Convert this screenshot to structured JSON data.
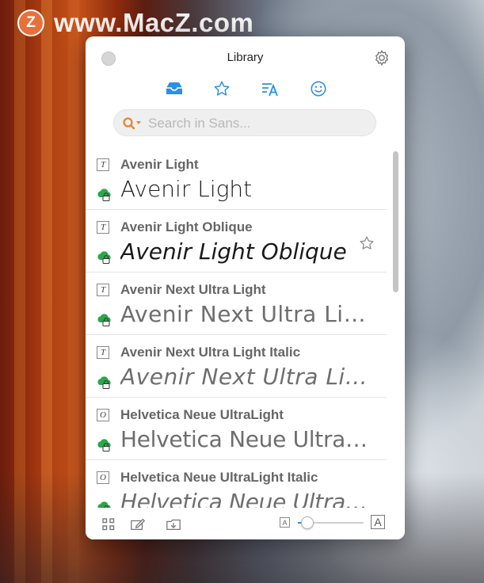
{
  "watermark": {
    "logo_letter": "Z",
    "text": "www.MacZ.com"
  },
  "window": {
    "title": "Library"
  },
  "tabs": [
    {
      "name": "inbox",
      "icon": "inbox-icon",
      "active": true
    },
    {
      "name": "favorites",
      "icon": "star-icon",
      "active": false
    },
    {
      "name": "font-type",
      "icon": "text-format-icon",
      "active": false
    },
    {
      "name": "emoji",
      "icon": "smiley-icon",
      "active": false
    }
  ],
  "search": {
    "placeholder": "Search in Sans...",
    "value": ""
  },
  "fonts": [
    {
      "name": "Avenir Light",
      "preview": "Avenir Light",
      "type_glyph": "T",
      "favorite": false
    },
    {
      "name": "Avenir Light Oblique",
      "preview": "Avenir Light Oblique",
      "type_glyph": "T",
      "favorite": true
    },
    {
      "name": "Avenir Next Ultra Light",
      "preview": "Avenir Next Ultra Light",
      "type_glyph": "T",
      "favorite": false
    },
    {
      "name": "Avenir Next Ultra Light Italic",
      "preview": "Avenir Next Ultra Ligh…",
      "type_glyph": "T",
      "favorite": false
    },
    {
      "name": "Helvetica Neue UltraLight",
      "preview": "Helvetica Neue UltraLight",
      "type_glyph": "O",
      "favorite": false
    },
    {
      "name": "Helvetica Neue UltraLight Italic",
      "preview": "Helvetica Neue UltraLig…",
      "type_glyph": "O",
      "favorite": false
    }
  ],
  "bottombar": {
    "size_small_label": "A",
    "size_large_label": "A",
    "preview_size_level": 0.15
  },
  "colors": {
    "accent": "#2b8fe6",
    "cloud_green": "#2aa84a",
    "search_icon_orange": "#e8842a"
  }
}
